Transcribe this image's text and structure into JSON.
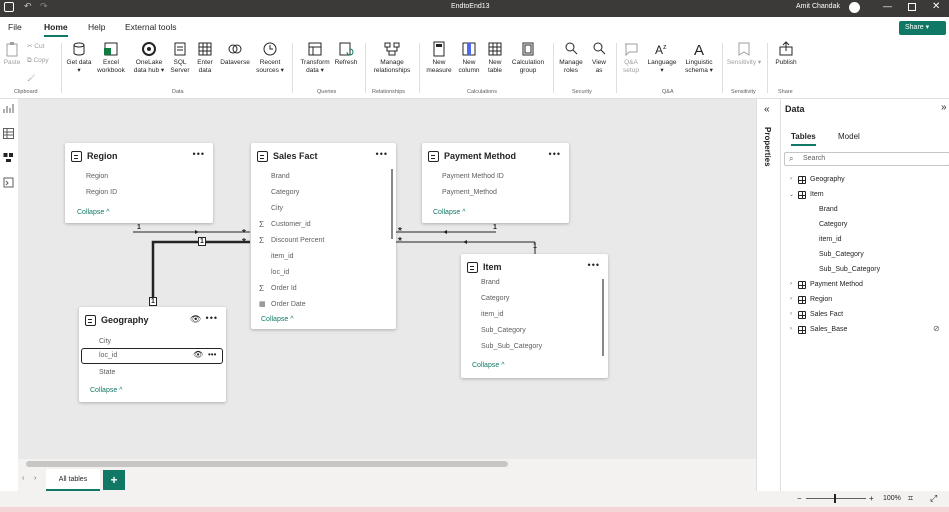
{
  "window": {
    "title": "EndtoEnd13",
    "user": "Amit Chandak"
  },
  "menu": {
    "tabs": [
      "File",
      "Home",
      "Help",
      "External tools"
    ],
    "share_label": "Share"
  },
  "ribbon": {
    "clipboard": {
      "paste": "Paste",
      "cut": "Cut",
      "copy": "Copy",
      "group": "Clipboard"
    },
    "data": {
      "get_data": "Get data",
      "excel": "Excel workbook",
      "onelake": "OneLake data hub",
      "sql": "SQL Server",
      "enter": "Enter data",
      "dataverse": "Dataverse",
      "recent": "Recent sources",
      "group": "Data"
    },
    "queries": {
      "transform": "Transform data",
      "refresh": "Refresh",
      "group": "Queries"
    },
    "relationships": {
      "manage": "Manage relationships",
      "group": "Relationships"
    },
    "calculations": {
      "new_measure": "New measure",
      "new_column": "New column",
      "new_table": "New table",
      "calc_group": "Calculation group",
      "group": "Calculations"
    },
    "security": {
      "manage_roles": "Manage roles",
      "view_as": "View as",
      "group": "Security"
    },
    "qa": {
      "qa_setup": "Q&A setup",
      "language": "Language",
      "linguistic": "Linguistic schema",
      "group": "Q&A"
    },
    "sensitivity": {
      "label": "Sensitivity",
      "group": "Sensitivity"
    },
    "share": {
      "publish": "Publish",
      "group": "Share"
    }
  },
  "cards": {
    "region": {
      "title": "Region",
      "fields": [
        "Region",
        "Region ID"
      ],
      "collapse": "Collapse"
    },
    "sales_fact": {
      "title": "Sales Fact",
      "fields": [
        "Brand",
        "Category",
        "City",
        "Customer_id",
        "Discount Percent",
        "item_id",
        "loc_id",
        "Order Id",
        "Order Date"
      ],
      "collapse": "Collapse"
    },
    "payment_method": {
      "title": "Payment Method",
      "fields": [
        "Payment Method ID",
        "Payment_Method"
      ],
      "collapse": "Collapse"
    },
    "item": {
      "title": "Item",
      "fields": [
        "Brand",
        "Category",
        "item_id",
        "Sub_Category",
        "Sub_Sub_Category"
      ],
      "collapse": "Collapse"
    },
    "geography": {
      "title": "Geography",
      "fields": [
        "City",
        "loc_id",
        "State"
      ],
      "collapse": "Collapse"
    }
  },
  "relationship_labels": {
    "one": "1",
    "many": "*"
  },
  "tabs": {
    "all_tables": "All tables",
    "add": "+"
  },
  "status": {
    "zoom": "100%"
  },
  "properties_label": "Properties",
  "data_pane": {
    "title": "Data",
    "tabs": [
      "Tables",
      "Model"
    ],
    "search_placeholder": "Search",
    "tree": [
      {
        "label": "Geography",
        "expanded": false
      },
      {
        "label": "Item",
        "expanded": true,
        "children": [
          "Brand",
          "Category",
          "item_id",
          "Sub_Category",
          "Sub_Sub_Category"
        ]
      },
      {
        "label": "Payment Method",
        "expanded": false
      },
      {
        "label": "Region",
        "expanded": false
      },
      {
        "label": "Sales Fact",
        "expanded": false
      },
      {
        "label": "Sales_Base",
        "expanded": false,
        "hidden": true
      }
    ]
  },
  "colors": {
    "accent": "#117865",
    "titlebar": "#3b3a39",
    "canvas": "#e9e9e9"
  }
}
